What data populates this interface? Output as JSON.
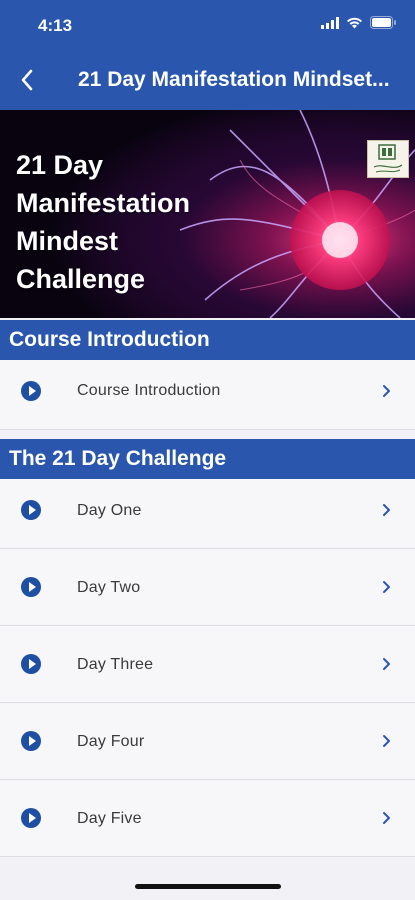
{
  "status_bar": {
    "time": "4:13"
  },
  "nav": {
    "title": "21 Day Manifestation Mindset..."
  },
  "hero": {
    "lines": [
      "21 Day",
      "Manifestation",
      "Mindest",
      "Challenge"
    ]
  },
  "sections": [
    {
      "title": "Course Introduction",
      "items": [
        "Course Introduction"
      ]
    },
    {
      "title": "The 21 Day Challenge",
      "items": [
        "Day One",
        "Day Two",
        "Day Three",
        "Day Four",
        "Day Five"
      ]
    }
  ],
  "colors": {
    "accent": "#2a57ad",
    "play_icon": "#1f4fa3",
    "row_bg": "#f7f7fa"
  }
}
